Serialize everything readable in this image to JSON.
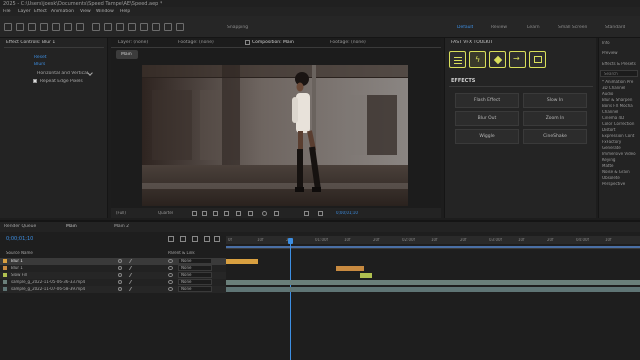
{
  "title": "2025 - C:\\Users\\joesk\\Documents\\Speed Tampe\\AE\\Speed.aep *",
  "menu": [
    "File",
    "Layer",
    "Effect",
    "Animation",
    "View",
    "Window",
    "Help"
  ],
  "toolbar": {
    "snapping_label": "Snapping",
    "workspaces": [
      "Default",
      "Review",
      "Learn",
      "Small Screen",
      "Standard"
    ],
    "active_workspace": "Default"
  },
  "left_panel": {
    "tab": "Effect Controls: Blur 1",
    "rows": [
      "Reset",
      "Blurs",
      "Horizontal and Vertical",
      "Repeat Edge Pixels"
    ]
  },
  "viewer": {
    "tabs": [
      "Layer: (none)",
      "Footage: (none)",
      "Composition: Main",
      "Footage: (none)"
    ],
    "active_tab_index": 2,
    "comp_badge": "Main",
    "zoom": "(Full)",
    "quality": "Quarter",
    "timecode": "0;00;01;10"
  },
  "ftv_panel": {
    "title": "FAST VFX TOOLKIT",
    "effects_heading": "EFFECTS",
    "effects": [
      "Flash Effect",
      "Slow In",
      "Blur Out",
      "Zoom In",
      "Wiggle",
      "CineShake"
    ],
    "accent": "#d9df5a"
  },
  "effects_list": {
    "tabs": [
      "Info",
      "Preview",
      "Effects & Presets"
    ],
    "search_placeholder": "Search",
    "items": [
      "* Animation Pre",
      "3D Channel",
      "Audio",
      "Blur & Sharpen",
      "Boris FX Mocha",
      "Channel",
      "Cinema 4D",
      "Color Correction",
      "Distort",
      "Expression Cont",
      "FxFactory",
      "Generate",
      "Immersive Video",
      "Keying",
      "Matte",
      "Noise & Grain",
      "Obsolete",
      "Perspective"
    ]
  },
  "timeline": {
    "tabs": [
      "Render Queue",
      "Main",
      "Main 2"
    ],
    "timecode": "0;00;01;10",
    "headers": [
      "Source Name",
      "Parent & Link"
    ],
    "layers": [
      {
        "name": "Blur 1",
        "parent": "None",
        "selected": true,
        "color": "#d9a040"
      },
      {
        "name": "Blur 1",
        "parent": "None",
        "selected": false,
        "color": "#c88a40"
      },
      {
        "name": "Slow Fill",
        "parent": "None",
        "selected": false,
        "color": "#b0c050"
      },
      {
        "name": "sample_g_2022-11-05-06-36-33.mp4",
        "parent": "None",
        "selected": false,
        "color": "#6a7f7a"
      },
      {
        "name": "sample_g_2022-11-07-06-58-39.mp4",
        "parent": "None",
        "selected": false,
        "color": "#5f7575"
      }
    ],
    "ruler_ticks": [
      "0f",
      "10f",
      "20f",
      "01:00f",
      "10f",
      "20f",
      "02:00f",
      "10f",
      "20f",
      "03:00f",
      "10f",
      "20f",
      "04:00f",
      "10f"
    ],
    "playhead_label": "01:10f"
  }
}
